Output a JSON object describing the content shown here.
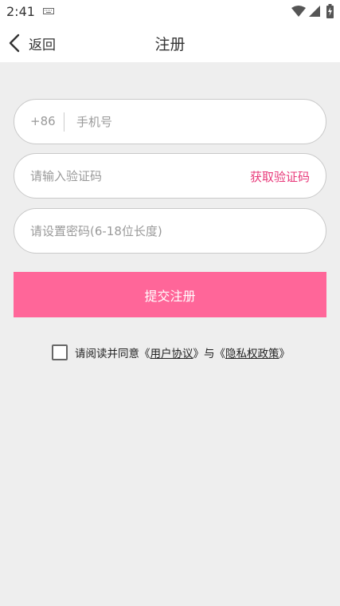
{
  "status_bar": {
    "time": "2:41"
  },
  "nav": {
    "back_label": "返回",
    "title": "注册"
  },
  "form": {
    "phone": {
      "country_code": "+86",
      "placeholder": "手机号",
      "value": ""
    },
    "code": {
      "placeholder": "请输入验证码",
      "value": "",
      "get_code_label": "获取验证码"
    },
    "password": {
      "placeholder": "请设置密码(6-18位长度)",
      "value": ""
    },
    "submit_label": "提交注册"
  },
  "agreement": {
    "checked": false,
    "prefix": "请阅读并同意",
    "open_quote_1": "《",
    "user_agreement": "用户协议",
    "close_quote_1": "》",
    "conjunction": "与",
    "open_quote_2": "《",
    "privacy_policy": "隐私权政策",
    "close_quote_2": "》"
  },
  "colors": {
    "accent": "#ff6699",
    "link_accent": "#e8397a",
    "background": "#eeeeee"
  }
}
